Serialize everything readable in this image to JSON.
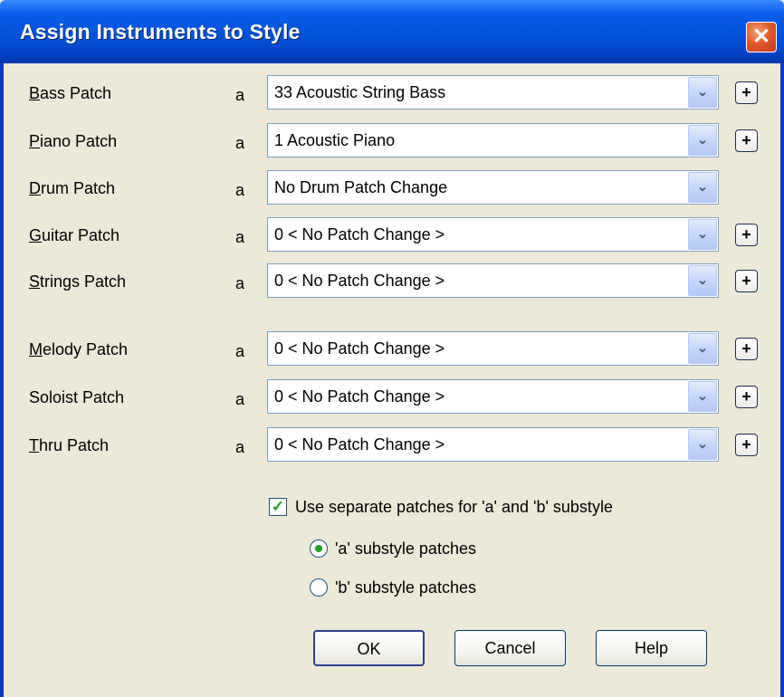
{
  "window": {
    "title": "Assign Instruments to Style",
    "close_glyph": "✕"
  },
  "patches": [
    {
      "key": "bass",
      "mnemonic": "B",
      "rest": "ass Patch",
      "substyle": "a",
      "value": "33 Acoustic String Bass",
      "has_plus": true
    },
    {
      "key": "piano",
      "mnemonic": "P",
      "rest": "iano Patch",
      "substyle": "a",
      "value": "1 Acoustic Piano",
      "has_plus": true
    },
    {
      "key": "drum",
      "mnemonic": "D",
      "rest": "rum Patch",
      "substyle": "a",
      "value": "No Drum Patch Change",
      "has_plus": false
    },
    {
      "key": "guitar",
      "mnemonic": "G",
      "rest": "uitar Patch",
      "substyle": "a",
      "value": "0 < No Patch Change >",
      "has_plus": true
    },
    {
      "key": "strings",
      "mnemonic": "S",
      "rest": "trings Patch",
      "substyle": "a",
      "value": "0 < No Patch Change >",
      "has_plus": true
    },
    {
      "key": "melody",
      "mnemonic": "M",
      "rest": "elody Patch",
      "substyle": "a",
      "value": "0 < No Patch Change >",
      "has_plus": true
    },
    {
      "key": "soloist",
      "mnemonic": "",
      "rest": "Soloist Patch",
      "substyle": "a",
      "value": "0 < No Patch Change >",
      "has_plus": true
    },
    {
      "key": "thru",
      "mnemonic": "T",
      "rest": "hru Patch",
      "substyle": "a",
      "value": "0 < No Patch Change >",
      "has_plus": true
    }
  ],
  "icons": {
    "dropdown": "chevron-down-icon",
    "plus": "+"
  },
  "glyphs": {
    "chevron": "⌄",
    "check": "✓",
    "plus": "+"
  },
  "separate_patches": {
    "label": "Use separate patches for 'a' and 'b' substyle",
    "checked": true
  },
  "substyle_radios": [
    {
      "label": "'a' substyle patches",
      "selected": true
    },
    {
      "label": "'b' substyle patches",
      "selected": false
    }
  ],
  "buttons": {
    "ok": "OK",
    "cancel": "Cancel",
    "help": "Help"
  },
  "colors": {
    "title_bar": "#0452D9",
    "face": "#ECE9D8",
    "close": "#E05A2B",
    "check": "#21A121"
  }
}
